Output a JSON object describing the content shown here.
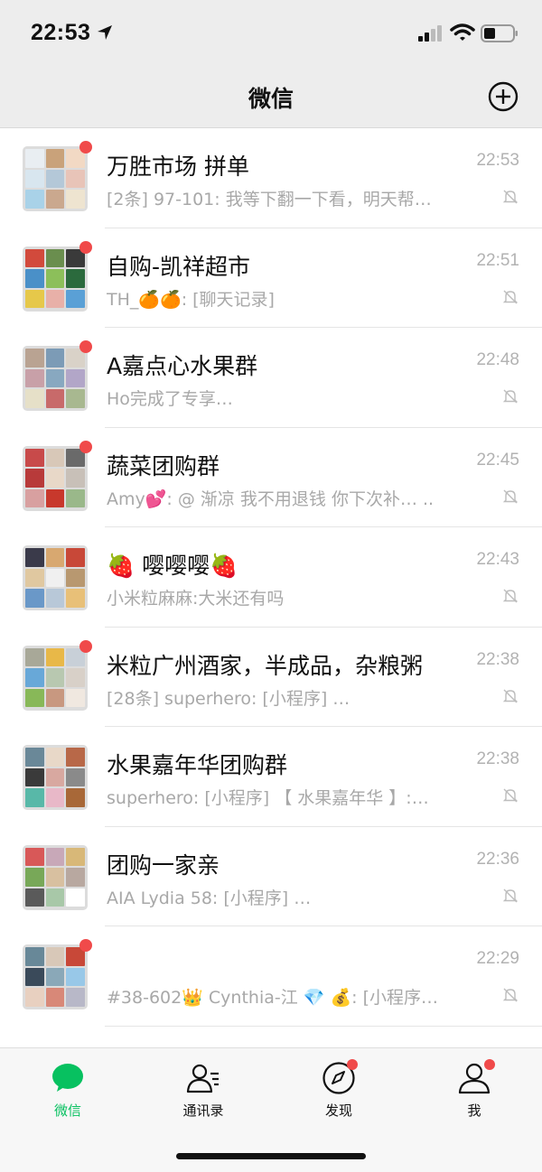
{
  "status_bar": {
    "time": "22:53"
  },
  "nav": {
    "title": "微信"
  },
  "chats": [
    {
      "name": "万胜市场 拼单",
      "time": "22:53",
      "preview": "[2条] 97-101: 我等下翻一下看，明天帮…",
      "unread": true
    },
    {
      "name": "自购-凯祥超市",
      "time": "22:51",
      "preview": "TH_🍊🍊: [聊天记录]",
      "unread": true
    },
    {
      "name": "A嘉点心水果群",
      "time": "22:48",
      "preview": "Ho完成了专享…",
      "unread": true
    },
    {
      "name": "蔬菜团购群",
      "time": "22:45",
      "preview": "Amy💕: @ 渐凉 我不用退钱 你下次补… ..",
      "unread": true
    },
    {
      "name": "🍓 嘤嘤嘤🍓",
      "time": "22:43",
      "preview": "小米粒麻麻:大米还有吗",
      "unread": false
    },
    {
      "name": "米粒广州酒家，半成品，杂粮粥",
      "time": "22:38",
      "preview": "[28条] superhero: [小程序]            …",
      "unread": true
    },
    {
      "name": "水果嘉年华团购群",
      "time": "22:38",
      "preview": "superhero: [小程序] 【 水果嘉年华 】:…",
      "unread": false
    },
    {
      "name": "团购一家亲",
      "time": "22:36",
      "preview": "AIA  Lydia 58: [小程序]               …",
      "unread": false
    },
    {
      "name": "",
      "time": "22:29",
      "preview": "#38-602👑 Cynthia-江 💎 💰: [小程序…",
      "unread": true
    }
  ],
  "tabs": [
    {
      "label": "微信",
      "icon": "chat-bubble-icon",
      "active": true
    },
    {
      "label": "通讯录",
      "icon": "contacts-icon",
      "active": false
    },
    {
      "label": "发现",
      "icon": "compass-icon",
      "active": false,
      "badge": true
    },
    {
      "label": "我",
      "icon": "person-icon",
      "active": false,
      "badge": true
    }
  ],
  "colors": {
    "accent_green": "#07c160",
    "badge_red": "#f04a4a",
    "background": "#ededed",
    "secondary_text": "#a8a8a8"
  }
}
